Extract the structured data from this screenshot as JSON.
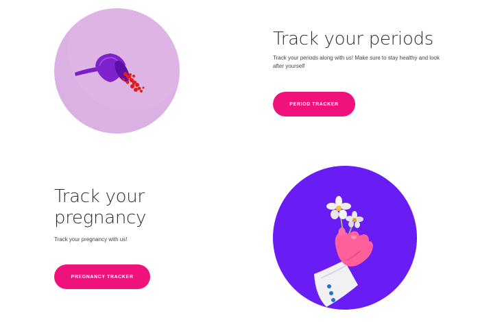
{
  "period": {
    "heading": "Track your periods",
    "description": "Track your periods along with us! Make sure to stay healthy and look after yourself",
    "button_label": "PERIOD TRACKER",
    "colors": {
      "circle_bg": "#d9aee0",
      "cup": "#7a22c6",
      "glitter": "#e01818"
    }
  },
  "pregnancy": {
    "heading_line1": "Track your",
    "heading_line2": "pregnancy",
    "description": "Track your pregnancy with us!",
    "button_label": "PREGNANCY TRACKER",
    "colors": {
      "circle_bg": "#6a1cf5",
      "hand": "#ff5f9a",
      "sleeve": "#f2f2f5"
    }
  },
  "accent": "#f0127b"
}
